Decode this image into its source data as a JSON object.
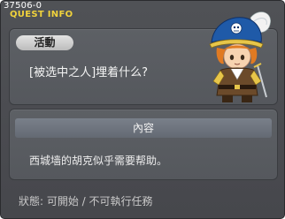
{
  "window": {
    "id": "37506-0",
    "title": "QUEST INFO"
  },
  "quest": {
    "category_badge": "活動",
    "name": "[被选中之人]埋着什么?"
  },
  "details": {
    "header": "內容",
    "description": "西城墙的胡克似乎需要帮助。"
  },
  "status": {
    "text": "狀態:  可開始  /  不可執行任務"
  },
  "colors": {
    "title": "#f0d23c",
    "window_bg": "#4a4b50",
    "panel_bg": "#5a5d62"
  },
  "icons": {
    "npc": "npc-portrait-icon"
  }
}
